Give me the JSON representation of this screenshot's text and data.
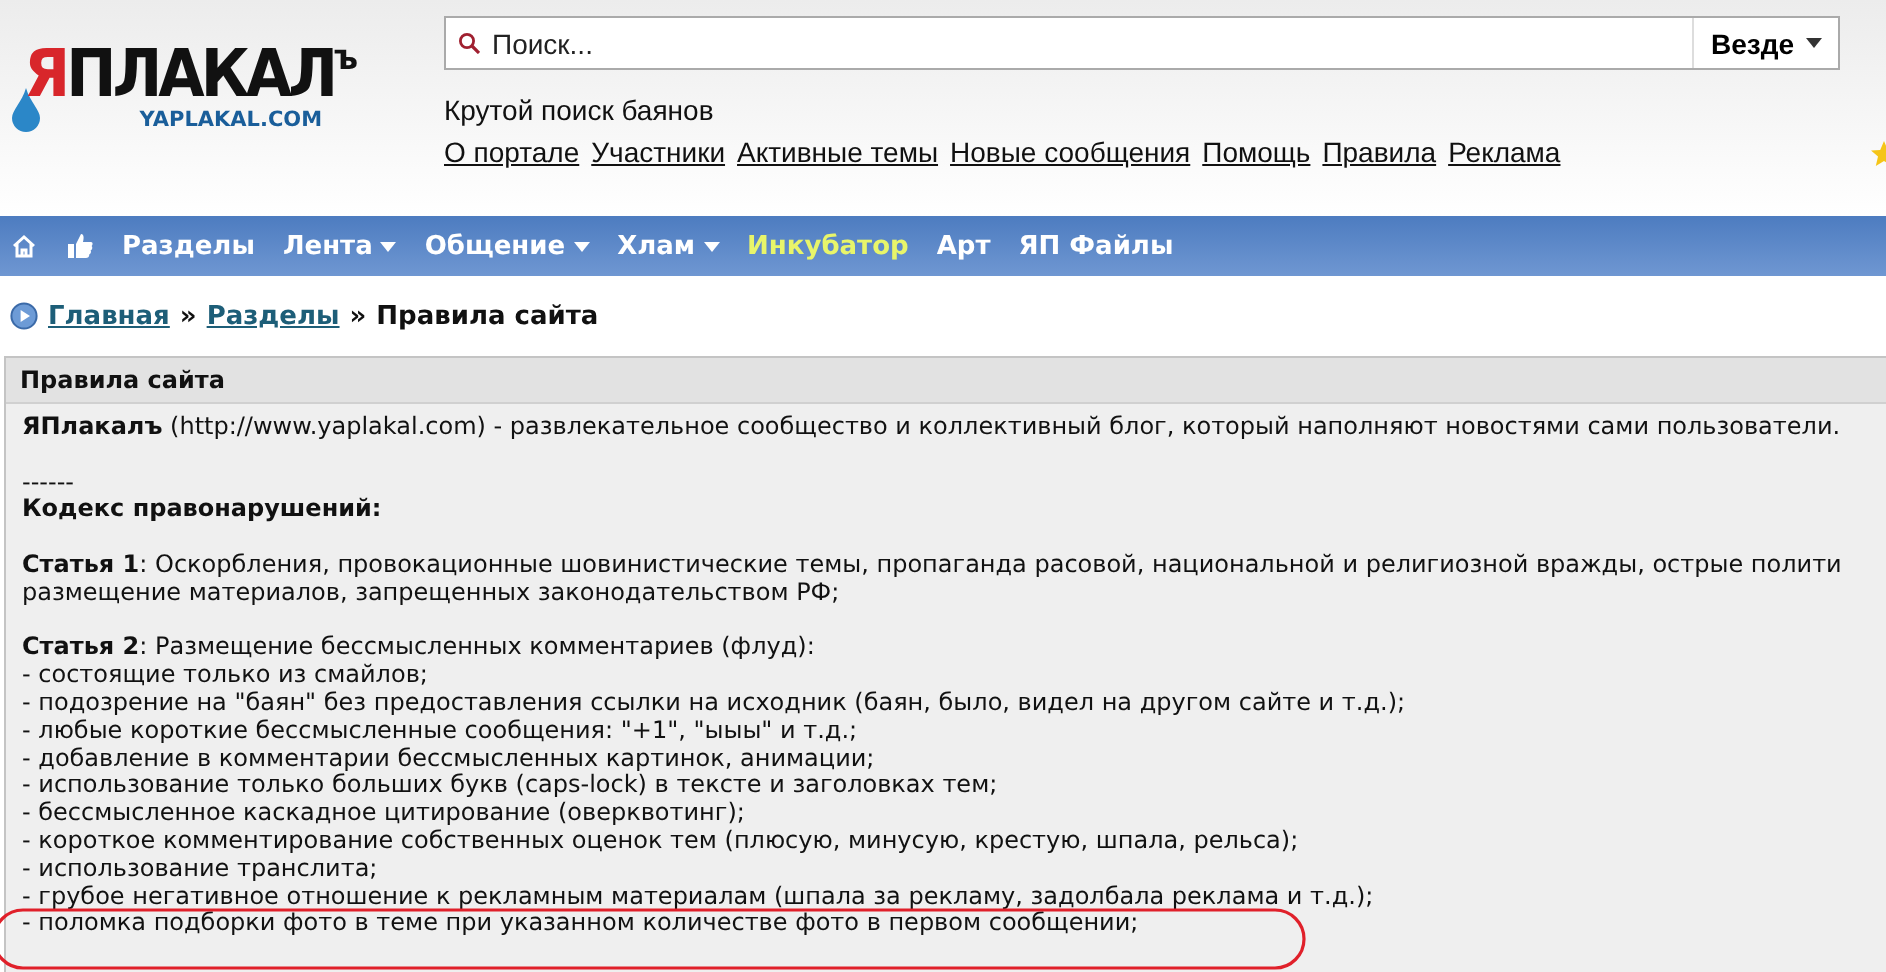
{
  "logo": {
    "first": "Я",
    "rest": "ПЛАКАЛ",
    "suffix": "ъ",
    "domain": "YAPLAKAL.COM"
  },
  "search": {
    "placeholder": "Поиск...",
    "scope": "Везде"
  },
  "tagline": "Крутой поиск баянов",
  "top_links": [
    "О портале",
    "Участники",
    "Активные темы",
    "Новые сообщения",
    "Помощь",
    "Правила",
    "Реклама"
  ],
  "nav": [
    {
      "label": "Разделы",
      "dropdown": false,
      "highlighted": false
    },
    {
      "label": "Лента",
      "dropdown": true,
      "highlighted": false
    },
    {
      "label": "Общение",
      "dropdown": true,
      "highlighted": false
    },
    {
      "label": "Хлам",
      "dropdown": true,
      "highlighted": false
    },
    {
      "label": "Инкубатор",
      "dropdown": false,
      "highlighted": true
    },
    {
      "label": "Арт",
      "dropdown": false,
      "highlighted": false
    },
    {
      "label": "ЯП Файлы",
      "dropdown": false,
      "highlighted": false
    }
  ],
  "breadcrumb": [
    {
      "kind": "link",
      "text": "Главная"
    },
    {
      "kind": "sep",
      "text": "»"
    },
    {
      "kind": "link",
      "text": "Разделы"
    },
    {
      "kind": "sep",
      "text": "»"
    },
    {
      "kind": "current",
      "text": "Правила сайта"
    }
  ],
  "panel": {
    "title": "Правила сайта",
    "blocks": [
      {
        "lines": [
          "**ЯПлакалъ** (http://www.yaplakal.com) - развлекательное сообщество и коллективный блог, который наполняют новостями сами пользователи."
        ]
      },
      {
        "lines": [
          "------",
          "**Кодекс правонарушений:**"
        ]
      },
      {
        "lines": [
          "**Статья 1**: Оскорбления, провокационные шовинистические темы, пропаганда расовой, национальной и религиозной вражды, острые полити",
          "размещение материалов, запрещенных законодательством РФ;"
        ]
      },
      {
        "lines": [
          "**Статья 2**: Размещение бессмысленных комментариев (флуд):",
          "- состоящие только из смайлов;",
          "- подозрение на \"баян\" без предоставления ссылки на исходник (баян, было, видел на другом сайте и т.д.);",
          "- любые короткие бессмысленные сообщения: \"+1\", \"ыыы\" и т.д.;",
          "- добавление в комментарии бессмысленных картинок, анимации;",
          "- использование только больших букв (caps-lock) в тексте и заголовках тем;",
          "- бессмысленное каскадное цитирование (оверквотинг);",
          "- короткое комментирование собственных оценок тем (плюсую, минусую, крестую, шпала, рельса);",
          "- использование транслита;",
          "- грубое негативное отношение к рекламным материалам (шпала за рекламу, задолбала реклама и т.д.);",
          "- поломка подборки фото в теме при указанном количестве фото в первом сообщении;"
        ]
      }
    ]
  }
}
